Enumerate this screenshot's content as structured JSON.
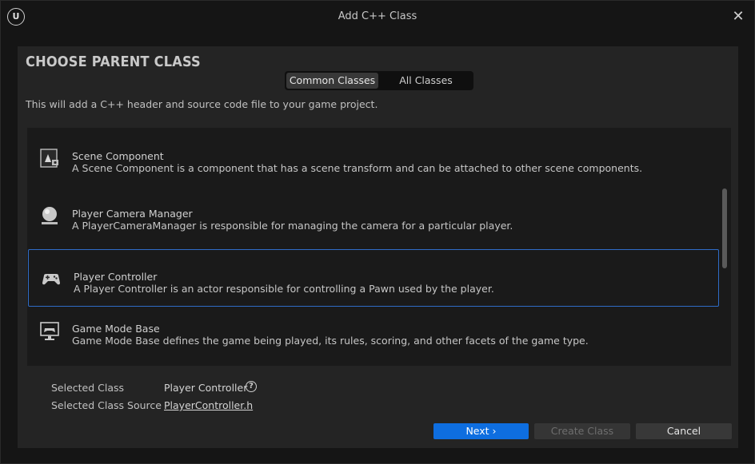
{
  "window": {
    "title": "Add C++ Class",
    "logo_icon": "unreal-engine-logo"
  },
  "heading": "CHOOSE PARENT CLASS",
  "tabs": [
    {
      "label": "Common Classes",
      "active": true
    },
    {
      "label": "All Classes",
      "active": false
    }
  ],
  "subtitle": "This will add a C++ header and source code file to your game project.",
  "classes": [
    {
      "icon": "scene-component-icon",
      "name": "Scene Component",
      "description": "A Scene Component is a component that has a scene transform and can be attached to other scene components."
    },
    {
      "icon": "camera-manager-icon",
      "name": "Player Camera Manager",
      "description": "A PlayerCameraManager is responsible for managing the camera for a particular player."
    },
    {
      "icon": "gamepad-icon",
      "name": "Player Controller",
      "description": "A Player Controller is an actor responsible for controlling a Pawn used by the player.",
      "selected": true
    },
    {
      "icon": "game-mode-icon",
      "name": "Game Mode Base",
      "description": "Game Mode Base defines the game being played, its rules, scoring, and other facets of the game type."
    }
  ],
  "selection": {
    "class_label": "Selected Class",
    "class_value": "Player Controller",
    "source_label": "Selected Class Source",
    "source_value": "PlayerController.h"
  },
  "buttons": {
    "next": "Next",
    "create": "Create Class",
    "cancel": "Cancel"
  },
  "colors": {
    "accent": "#0e6ee0",
    "selection_border": "#2f6cc7"
  }
}
